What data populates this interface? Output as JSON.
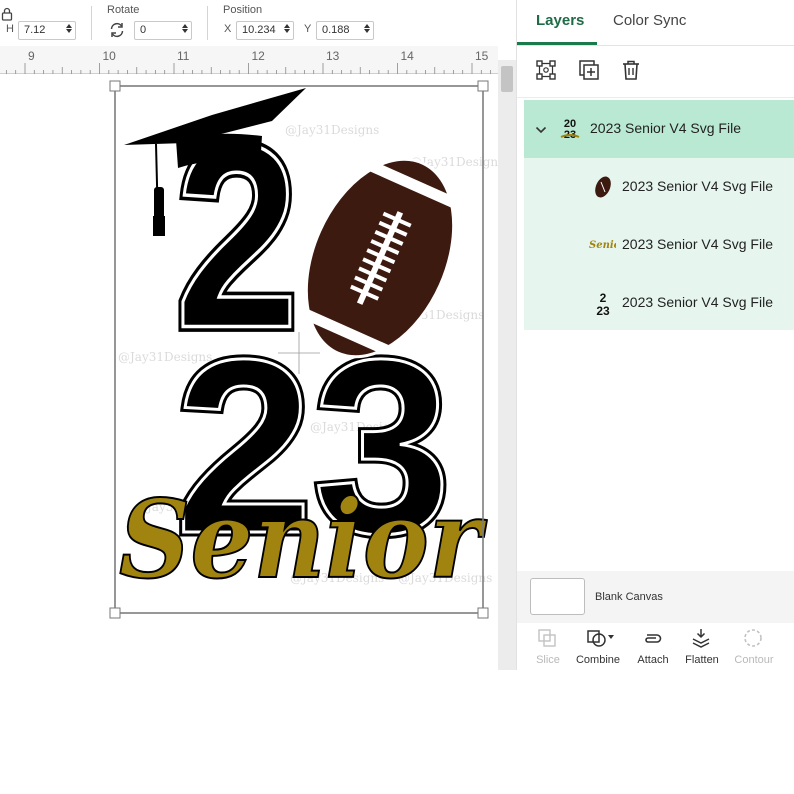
{
  "toolbar": {
    "h_label": "H",
    "h_value": "7.12",
    "rotate_label": "Rotate",
    "rotate_value": "0",
    "position_label": "Position",
    "x_label": "X",
    "x_value": "10.234",
    "y_label": "Y",
    "y_value": "0.188"
  },
  "ruler": {
    "marks": [
      "9",
      "10",
      "11",
      "12",
      "13",
      "14",
      "15"
    ]
  },
  "design": {
    "digits_top": "2",
    "digits_bottom": "23",
    "script_word": "Senior",
    "watermark": "@Jay31Designs",
    "colors": {
      "black": "#000000",
      "gold": "#a1840f",
      "football": "#3c1a10"
    }
  },
  "panel": {
    "tabs": [
      "Layers",
      "Color Sync"
    ],
    "active_tab": "Layers",
    "group": {
      "name": "2023 Senior V4 Svg File",
      "expanded": true
    },
    "layers": [
      {
        "name": "2023 Senior V4 Svg File",
        "thumb": "football-icon"
      },
      {
        "name": "2023 Senior V4 Svg File",
        "thumb": "senior-text-icon"
      },
      {
        "name": "2023 Senior V4 Svg File",
        "thumb": "2023-numbers-icon"
      }
    ],
    "blank_canvas": "Blank Canvas",
    "actions": [
      {
        "label": "Slice",
        "enabled": false
      },
      {
        "label": "Combine",
        "enabled": true
      },
      {
        "label": "Attach",
        "enabled": true
      },
      {
        "label": "Flatten",
        "enabled": true
      },
      {
        "label": "Contour",
        "enabled": false
      }
    ]
  }
}
